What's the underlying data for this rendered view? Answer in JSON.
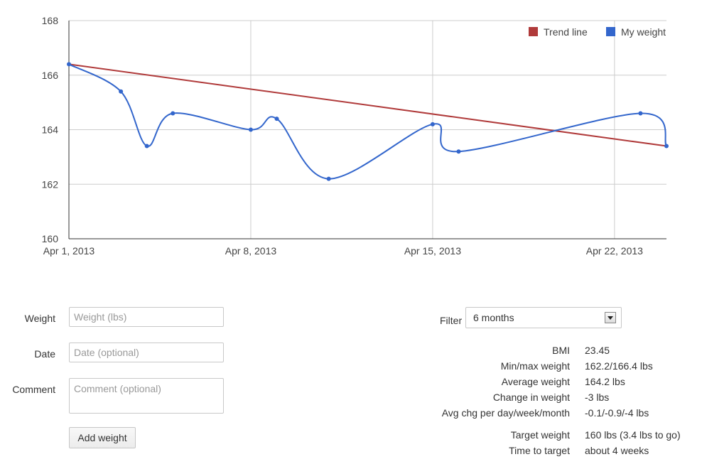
{
  "chart_data": {
    "type": "line",
    "x_tick_labels": [
      "Apr 1, 2013",
      "Apr 8, 2013",
      "Apr 15, 2013",
      "Apr 22, 2013"
    ],
    "ylim": [
      160,
      168
    ],
    "y_ticks": [
      160,
      162,
      164,
      166,
      168
    ],
    "grid": true,
    "legend_position": "top-right",
    "series": [
      {
        "name": "Trend line",
        "color": "#b03a3a",
        "points": [
          [
            "Apr 1, 2013",
            166.4
          ],
          [
            "Apr 24, 2013",
            163.4
          ]
        ]
      },
      {
        "name": "My weight",
        "color": "#3366cc",
        "points": [
          [
            "Apr 1, 2013",
            166.4
          ],
          [
            "Apr 3, 2013",
            165.4
          ],
          [
            "Apr 4, 2013",
            163.4
          ],
          [
            "Apr 5, 2013",
            164.6
          ],
          [
            "Apr 8, 2013",
            164.0
          ],
          [
            "Apr 9, 2013",
            164.4
          ],
          [
            "Apr 11, 2013",
            162.2
          ],
          [
            "Apr 15, 2013",
            164.2
          ],
          [
            "Apr 16, 2013",
            163.2
          ],
          [
            "Apr 23, 2013",
            164.6
          ],
          [
            "Apr 24, 2013",
            163.4
          ]
        ]
      }
    ]
  },
  "form": {
    "weight_label": "Weight",
    "weight_placeholder": "Weight (lbs)",
    "date_label": "Date",
    "date_placeholder": "Date (optional)",
    "comment_label": "Comment",
    "comment_placeholder": "Comment (optional)",
    "submit_label": "Add weight"
  },
  "filter": {
    "label": "Filter",
    "selected": "6 months"
  },
  "stats": [
    {
      "label": "BMI",
      "value": "23.45"
    },
    {
      "label": "Min/max weight",
      "value": "162.2/166.4 lbs"
    },
    {
      "label": "Average weight",
      "value": "164.2 lbs"
    },
    {
      "label": "Change in weight",
      "value": "-3 lbs"
    },
    {
      "label": "Avg chg per day/week/month",
      "value": "-0.1/-0.9/-4 lbs"
    }
  ],
  "target": [
    {
      "label": "Target weight",
      "value": "160 lbs (3.4 lbs to go)"
    },
    {
      "label": "Time to target",
      "value": "about 4 weeks"
    }
  ]
}
